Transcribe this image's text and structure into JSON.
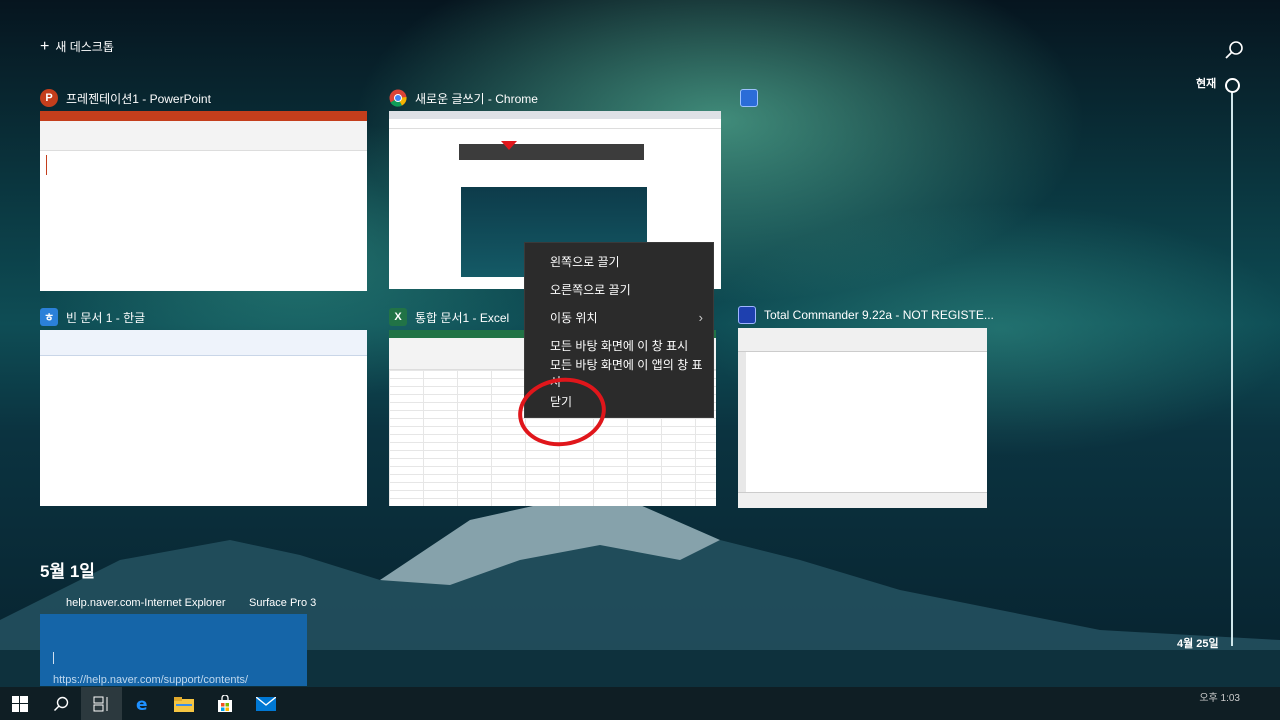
{
  "top": {
    "new_desktop_label": "새 데스크톱",
    "timeline_now": "현재",
    "timeline_bottom_date": "4월 25일"
  },
  "windows": [
    {
      "title": "프레젠테이션1 - PowerPoint",
      "icon": "powerpoint-icon",
      "icon_letter": "P",
      "color": "#c43e1c"
    },
    {
      "title": "새로운 글쓰기 - Chrome",
      "icon": "chrome-icon",
      "icon_letter": "",
      "color": "#4285f4"
    },
    {
      "title": "",
      "icon": "store-app-icon",
      "icon_letter": "",
      "color": "#2b6cd8"
    },
    {
      "title": "빈 문서 1 - 한글",
      "icon": "hangul-icon",
      "icon_letter": "ㅎ",
      "color": "#2b80d9"
    },
    {
      "title": "통합 문서1 - Excel",
      "icon": "excel-icon",
      "icon_letter": "X",
      "color": "#217346"
    },
    {
      "title": "Total Commander 9.22a - NOT REGISTE...",
      "icon": "total-commander-icon",
      "icon_letter": "",
      "color": "#1e40af"
    }
  ],
  "context_menu": {
    "items": [
      {
        "label": "왼쪽으로 끌기",
        "submenu": false
      },
      {
        "label": "오른쪽으로 끌기",
        "submenu": false
      },
      {
        "label": "이동 위치",
        "submenu": true
      },
      {
        "label": "모든 바탕 화면에 이 창 표시",
        "submenu": false
      },
      {
        "label": "모든 바탕 화면에 이 앱의 창 표시",
        "submenu": false
      },
      {
        "label": "닫기",
        "submenu": false
      }
    ]
  },
  "timeline": {
    "date_heading": "5월 1일",
    "activities": [
      {
        "label": "help.naver.com-Internet Explorer"
      },
      {
        "label": "Surface Pro 3"
      }
    ],
    "card_url": "https://help.naver.com/support/contents/"
  },
  "taskbar": {
    "items": [
      "start-icon",
      "search-icon",
      "task-view-icon",
      "edge-icon",
      "file-explorer-icon",
      "store-icon",
      "mail-icon"
    ],
    "clock": "오후 1:03"
  },
  "colors": {
    "annotation_red": "#e0161b",
    "menu_bg": "#2b2b2b",
    "taskbar_bg": "#0f1e24"
  }
}
